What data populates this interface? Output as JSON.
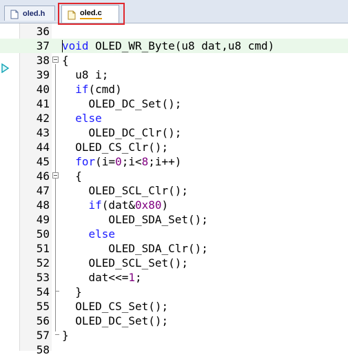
{
  "tabs": [
    {
      "label": "oled.h",
      "active": false
    },
    {
      "label": "oled.c",
      "active": true
    }
  ],
  "colors": {
    "keyword": "#1a1aff",
    "number": "#800080",
    "current_line": "#eaf8ea",
    "highlight": "#e0262c"
  },
  "editor": {
    "lines": [
      {
        "num": "36",
        "code": ""
      },
      {
        "num": "37",
        "code": "void OLED_WR_Byte(u8 dat,u8 cmd)"
      },
      {
        "num": "38",
        "code": "{"
      },
      {
        "num": "39",
        "code": "  u8 i;"
      },
      {
        "num": "40",
        "code": "  if(cmd)"
      },
      {
        "num": "41",
        "code": "    OLED_DC_Set();"
      },
      {
        "num": "42",
        "code": "  else"
      },
      {
        "num": "43",
        "code": "    OLED_DC_Clr();"
      },
      {
        "num": "44",
        "code": "  OLED_CS_Clr();"
      },
      {
        "num": "45",
        "code": "  for(i=0;i<8;i++)"
      },
      {
        "num": "46",
        "code": "  {"
      },
      {
        "num": "47",
        "code": "    OLED_SCL_Clr();"
      },
      {
        "num": "48",
        "code": "    if(dat&0x80)"
      },
      {
        "num": "49",
        "code": "       OLED_SDA_Set();"
      },
      {
        "num": "50",
        "code": "    else"
      },
      {
        "num": "51",
        "code": "       OLED_SDA_Clr();"
      },
      {
        "num": "52",
        "code": "    OLED_SCL_Set();"
      },
      {
        "num": "53",
        "code": "    dat<<=1;"
      },
      {
        "num": "54",
        "code": "  }"
      },
      {
        "num": "55",
        "code": "  OLED_CS_Set();"
      },
      {
        "num": "56",
        "code": "  OLED_DC_Set();"
      },
      {
        "num": "57",
        "code": "}"
      },
      {
        "num": "58",
        "code": ""
      }
    ]
  }
}
